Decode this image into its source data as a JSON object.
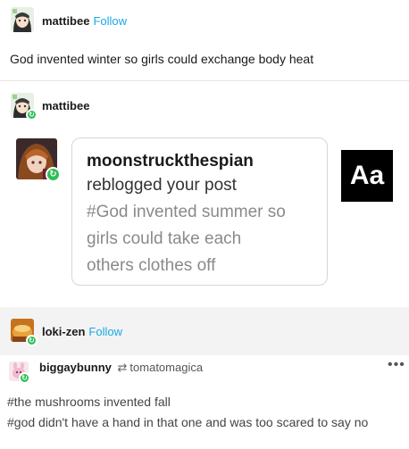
{
  "post1": {
    "username": "mattibee",
    "follow_label": "Follow",
    "text": "God invented winter so girls could exchange body heat"
  },
  "post2": {
    "username": "mattibee",
    "notification": {
      "user": "moonstruckthespian",
      "action": "reblogged your post",
      "quote_line1": "#God invented summer so",
      "quote_line2": "girls could take each",
      "quote_line3": "others clothes off"
    },
    "text_style_icon": "Aa"
  },
  "post3": {
    "username": "loki-zen",
    "follow_label": "Follow"
  },
  "post4": {
    "username": "biggaybunny",
    "reblog_from": "tomatomagica",
    "tag1": "#the mushrooms invented fall",
    "tag2": "#god didn't have a hand in that one and was too scared to say no",
    "more_label": "•••"
  }
}
